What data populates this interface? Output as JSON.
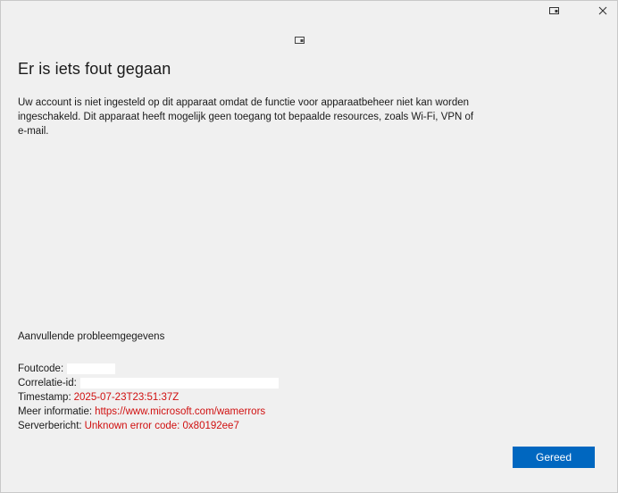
{
  "titlebar": {
    "cast_icon": "cast-to-device-icon",
    "close_icon": "close-icon"
  },
  "header_icon": "cast-to-device-icon",
  "dialog": {
    "title": "Er is iets fout gegaan",
    "message": "Uw account is niet ingesteld op dit apparaat omdat de functie voor apparaatbeheer niet kan worden ingeschakeld. Dit apparaat heeft mogelijk geen toegang tot bepaalde resources, zoals Wi-Fi, VPN of e-mail."
  },
  "details": {
    "heading": "Aanvullende probleemgegevens",
    "error_code_label": "Foutcode:",
    "error_code_value": "",
    "correlation_label": "Correlatie-id:",
    "correlation_value": "",
    "timestamp_label": "Timestamp:",
    "timestamp_value": "2025-07-23T23:51:37Z",
    "more_info_label": "Meer informatie:",
    "more_info_value": "https://www.microsoft.com/wamerrors",
    "server_message_label": "Serverbericht:",
    "server_message_value": "Unknown error code: 0x80192ee7"
  },
  "actions": {
    "done_label": "Gereed"
  },
  "colors": {
    "accent": "#0067c0",
    "error_text": "#d01010",
    "background": "#f0f0f0"
  }
}
